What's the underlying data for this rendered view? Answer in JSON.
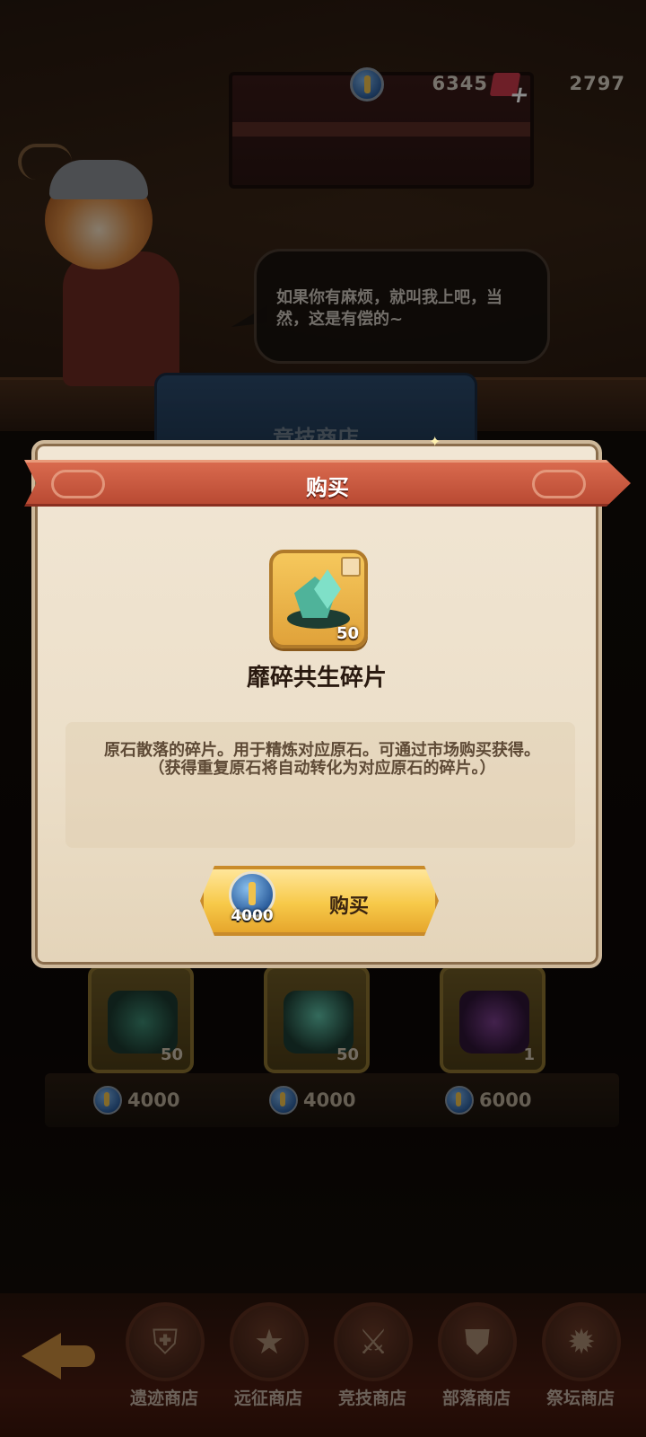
{
  "currency": {
    "coin_value": "6345",
    "gem_value": "2797",
    "coin_icon": "blue-wheat-coin",
    "gem_icon": "red-gem"
  },
  "npc": {
    "speech": "如果你有麻烦，就叫我上吧，当然，这是有偿的~"
  },
  "shop_tab": {
    "label": "竞技商店"
  },
  "dialog": {
    "title": "购买",
    "item": {
      "name": "靡碎共生碎片",
      "quantity": "50",
      "icon": "green-crystal-fragment"
    },
    "description": "原石散落的碎片。用于精炼对应原石。可通过市场购买获得。（获得重复原石将自动转化为对应原石的碎片。）",
    "buy_button": {
      "label": "购买",
      "price": "4000"
    }
  },
  "shop_items": [
    {
      "quantity": "50",
      "price": "4000",
      "icon": "green-crystal-fragment"
    },
    {
      "quantity": "50",
      "price": "4000",
      "icon": "green-crystal-fragment"
    },
    {
      "quantity": "1",
      "price": "6000",
      "icon": "purple-eye-rune"
    }
  ],
  "bottom_nav": [
    {
      "label": "遗迹商店",
      "icon": "armor-icon"
    },
    {
      "label": "远征商店",
      "icon": "star-card-icon"
    },
    {
      "label": "竞技商店",
      "icon": "crossed-swords-icon"
    },
    {
      "label": "部落商店",
      "icon": "shield-icon"
    },
    {
      "label": "祭坛商店",
      "icon": "flame-icon"
    }
  ],
  "colors": {
    "ribbon": "#c95a40",
    "button": "#f7c949",
    "dialog_bg": "#ecdfc9"
  }
}
